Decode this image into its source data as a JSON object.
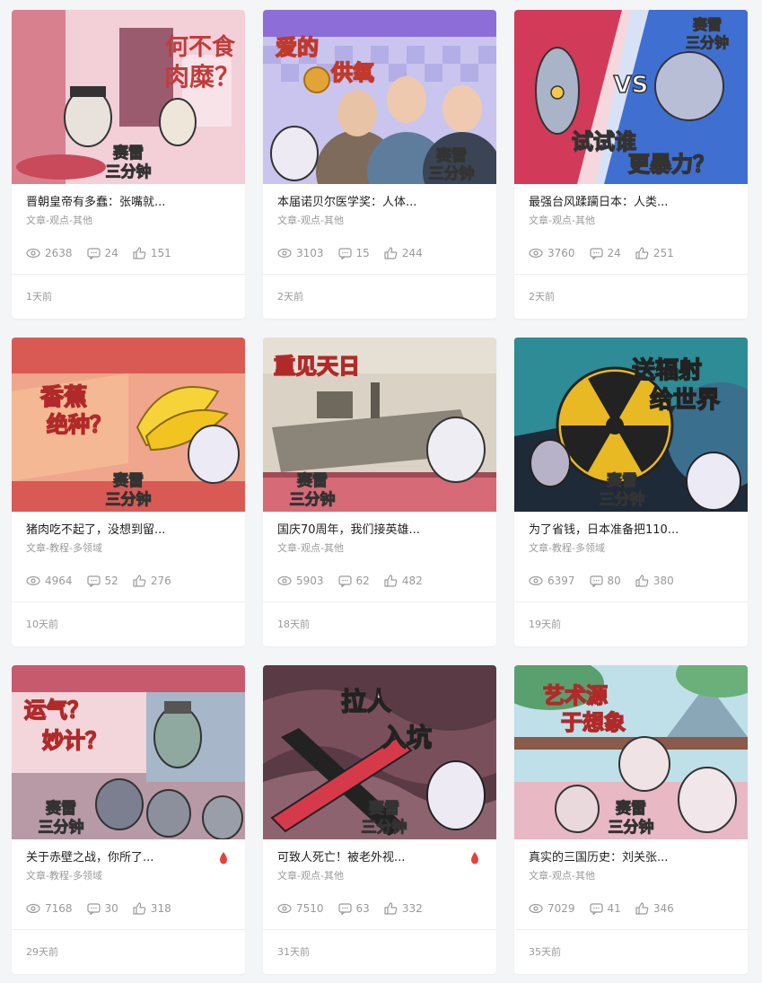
{
  "cards": [
    {
      "title": "晋朝皇帝有多蠢：张嘴就...",
      "category": "文章-观点-其他",
      "views": "2638",
      "comments": "24",
      "likes": "151",
      "time": "1天前",
      "thumb_text": [
        "何不食",
        "肉糜？"
      ],
      "hot": false
    },
    {
      "title": "本届诺贝尔医学奖：人体...",
      "category": "文章-观点-其他",
      "views": "3103",
      "comments": "15",
      "likes": "244",
      "time": "2天前",
      "thumb_text": [
        "爱的",
        "供氧"
      ],
      "hot": false
    },
    {
      "title": "最强台风蹂躏日本：人类...",
      "category": "文章-观点-其他",
      "views": "3760",
      "comments": "24",
      "likes": "251",
      "time": "2天前",
      "thumb_text": [
        "VS",
        "试试谁",
        "更暴力？"
      ],
      "hot": false
    },
    {
      "title": "猪肉吃不起了，没想到留...",
      "category": "文章-教程-多领域",
      "views": "4964",
      "comments": "52",
      "likes": "276",
      "time": "10天前",
      "thumb_text": [
        "香蕉",
        "绝种？"
      ],
      "hot": false
    },
    {
      "title": "国庆70周年，我们接英雄...",
      "category": "文章-观点-其他",
      "views": "5903",
      "comments": "62",
      "likes": "482",
      "time": "18天前",
      "thumb_text": [
        "重见天日"
      ],
      "hot": false
    },
    {
      "title": "为了省钱，日本准备把110...",
      "category": "文章-教程-多领域",
      "views": "6397",
      "comments": "80",
      "likes": "380",
      "time": "19天前",
      "thumb_text": [
        "送辐射",
        "给世界"
      ],
      "hot": false
    },
    {
      "title": "关于赤壁之战，你所了...",
      "category": "文章-教程-多领域",
      "views": "7168",
      "comments": "30",
      "likes": "318",
      "time": "29天前",
      "thumb_text": [
        "运气？",
        "妙计？"
      ],
      "hot": true
    },
    {
      "title": "可致人死亡！被老外视...",
      "category": "文章-观点-其他",
      "views": "7510",
      "comments": "63",
      "likes": "332",
      "time": "31天前",
      "thumb_text": [
        "拉人",
        "入坑"
      ],
      "hot": true
    },
    {
      "title": "真实的三国历史：刘关张...",
      "category": "文章-观点-其他",
      "views": "7029",
      "comments": "41",
      "likes": "346",
      "time": "35天前",
      "thumb_text": [
        "艺术源",
        "于想象"
      ],
      "hot": false
    }
  ],
  "brand_stamp": [
    "赛雷",
    "三分钟"
  ],
  "colors": {
    "hot": "#e8413c",
    "meta": "#9a9a9a",
    "title": "#222222",
    "page_bg": "#f4f5f7"
  },
  "icons": {
    "views": "eye-icon",
    "comments": "comment-icon",
    "likes": "thumb-up-icon",
    "hot": "flame-icon"
  }
}
